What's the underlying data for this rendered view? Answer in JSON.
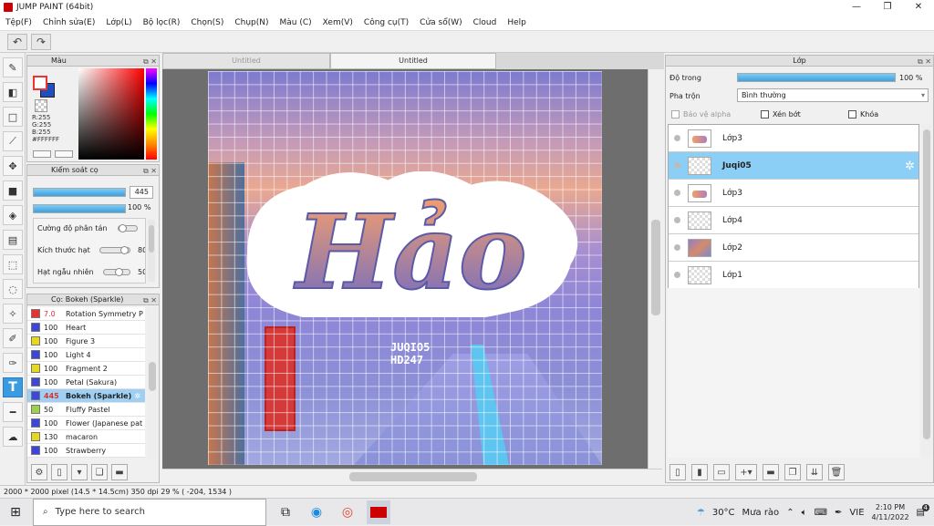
{
  "window": {
    "title": "JUMP PAINT (64bit)",
    "minimize": "—",
    "restore": "❐",
    "close": "✕"
  },
  "menu": [
    "Tệp(F)",
    "Chỉnh sửa(E)",
    "Lớp(L)",
    "Bộ lọc(R)",
    "Chọn(S)",
    "Chụp(N)",
    "Màu (C)",
    "Xem(V)",
    "Công cụ(T)",
    "Cửa sổ(W)",
    "Cloud",
    "Help"
  ],
  "toolbar": {
    "undo_icon": "undo-icon",
    "redo_icon": "redo-icon"
  },
  "tabs": [
    {
      "label": "Untitled",
      "active": false
    },
    {
      "label": "Untitled",
      "active": true
    }
  ],
  "color_panel": {
    "title": "Màu",
    "r": "R:255",
    "g": "G:255",
    "b": "B:255",
    "hex": "#FFFFFF",
    "fg": "#ffffff",
    "bg": "#1f4fbf"
  },
  "brush_control": {
    "title": "Kiểm soát cọ",
    "size_value": "445",
    "opacity_value": "100 %",
    "scatter_label": "Cường độ phân tán",
    "particle_size_label": "Kích thước hạt",
    "particle_size_value": "80",
    "random_label": "Hạt ngẫu nhiên",
    "random_value": "50"
  },
  "brush_list": {
    "title": "Cọ: Bokeh (Sparkle)",
    "items": [
      {
        "size": "7.0",
        "name": "Rotation Symmetry P",
        "color": "#e63232",
        "selected": false,
        "size_red": true
      },
      {
        "size": "100",
        "name": "Heart",
        "color": "#3c46d8",
        "selected": false
      },
      {
        "size": "100",
        "name": "Figure 3",
        "color": "#e8d81c",
        "selected": false
      },
      {
        "size": "100",
        "name": "Light 4",
        "color": "#3c46d8",
        "selected": false
      },
      {
        "size": "100",
        "name": "Fragment 2",
        "color": "#e8d81c",
        "selected": false
      },
      {
        "size": "100",
        "name": "Petal (Sakura)",
        "color": "#3c46d8",
        "selected": false
      },
      {
        "size": "445",
        "name": "Bokeh (Sparkle)",
        "color": "#3c46d8",
        "selected": true,
        "size_red": true
      },
      {
        "size": "50",
        "name": "Fluffy Pastel",
        "color": "#9ad24a",
        "selected": false
      },
      {
        "size": "100",
        "name": "Flower (Japanese pat",
        "color": "#3c46d8",
        "selected": false
      },
      {
        "size": "130",
        "name": "macaron",
        "color": "#e8d81c",
        "selected": false
      },
      {
        "size": "100",
        "name": "Strawberry",
        "color": "#3c46d8",
        "selected": false
      }
    ]
  },
  "artwork": {
    "title_text": "Hảo",
    "watermark_line1": "JUQIO5",
    "watermark_line2": "HD247"
  },
  "layers_panel": {
    "title": "Lớp",
    "opacity_label": "Độ trong",
    "opacity_value": "100 %",
    "opacity_fraction": 1.0,
    "blend_label": "Pha trộn",
    "blend_value": "Bình thường",
    "protect_alpha": "Bảo vệ alpha",
    "clip": "Xén bớt",
    "lock": "Khóa",
    "items": [
      {
        "name": "Lớp3",
        "thumb": "txt",
        "selected": false
      },
      {
        "name": "Juqi05",
        "thumb": "blank",
        "selected": true
      },
      {
        "name": "Lớp3",
        "thumb": "txt",
        "selected": false
      },
      {
        "name": "Lớp4",
        "thumb": "blank",
        "selected": false
      },
      {
        "name": "Lớp2",
        "thumb": "img",
        "selected": false
      },
      {
        "name": "Lớp1",
        "thumb": "blank",
        "selected": false
      }
    ]
  },
  "status": {
    "text": "2000 * 2000 pixel  (14.5 * 14.5cm)  350 dpi  29 %  ( -204, 1534 )"
  },
  "taskbar": {
    "search_placeholder": "Type here to search",
    "weather_temp": "30°C",
    "weather_text": "Mưa rào",
    "lang": "VIE",
    "time": "2:10 PM",
    "date": "4/11/2022",
    "notification_count": "4"
  }
}
